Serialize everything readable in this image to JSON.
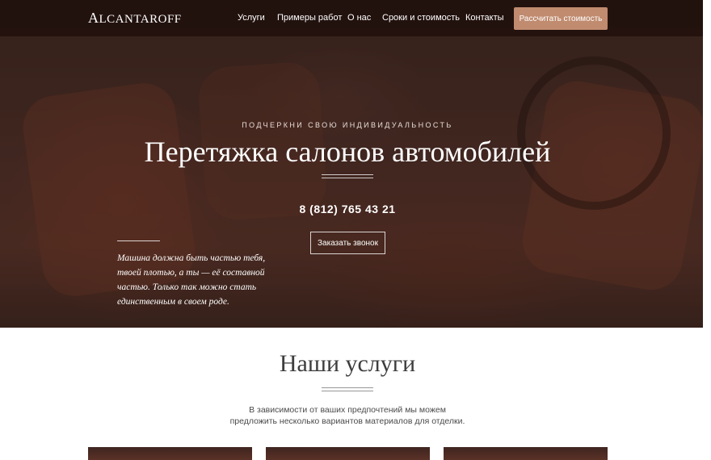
{
  "nav": {
    "logo_initial": "A",
    "logo_rest": "LCANTAROFF",
    "links": [
      "Услуги",
      "Примеры работ",
      "О нас",
      "Сроки и стоимость",
      "Контакты"
    ],
    "cta_label": "Рассчитать стоимость"
  },
  "hero": {
    "tagline": "ПОДЧЕРКНИ СВОЮ ИНДИВИДУАЛЬНОСТЬ",
    "title": "Перетяжка салонов автомобилей",
    "phone": "8 (812) 765 43 21",
    "callback_label": "Заказать звонок",
    "quote": "Машина должна быть частью тебя, твоей плотью, а ты — её составной частью. Только так можно стать единственным в своем роде."
  },
  "services": {
    "title": "Наши услуги",
    "description": "В зависимости от ваших предпочтений мы можем предложить несколько вариантов материалов для отделки."
  },
  "colors": {
    "accent": "#c08b6f",
    "nav_bg": "#1e0e0a",
    "hero_tone": "#4b2e27"
  }
}
